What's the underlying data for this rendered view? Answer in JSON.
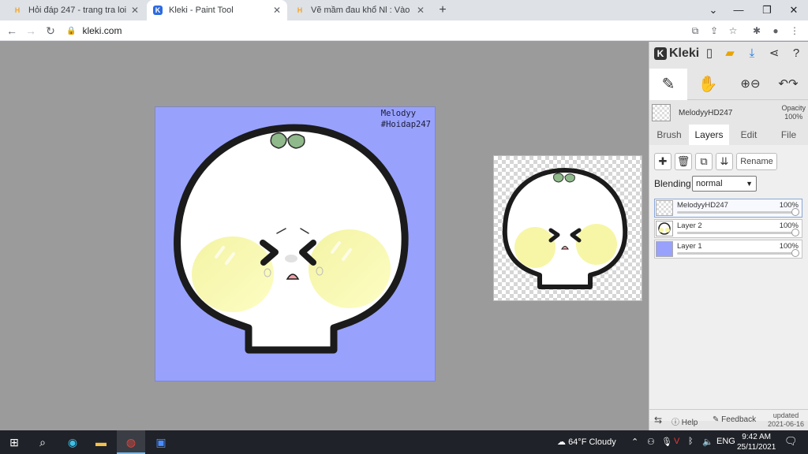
{
  "browser": {
    "tabs": [
      {
        "favicon": "H",
        "title": "Hỏi đáp 247 - trang tra loi",
        "active": false
      },
      {
        "favicon": "K",
        "title": "Kleki - Paint Tool",
        "active": true
      },
      {
        "favicon": "H",
        "title": "Vẽ mầm đau khổ Nl : Vào câu hỏi",
        "active": false
      }
    ],
    "close_glyph": "✕",
    "new_tab_glyph": "+",
    "url": "kleki.com",
    "window_controls": [
      "⌄",
      "—",
      "❐",
      "✕"
    ]
  },
  "artwork": {
    "watermark_line1": "Melodyy",
    "watermark_line2": "#Hoidap247",
    "background_color": "#98a2fd",
    "blush_color": "#fafaa8"
  },
  "kleki": {
    "logo": "Kleki",
    "current_layer_name": "MelodyyHD247",
    "opacity_label": "Opacity",
    "opacity_value": "100%",
    "tabs": [
      "Brush",
      "Layers",
      "Edit",
      "File"
    ],
    "active_tab": "Layers",
    "rename_label": "Rename",
    "blending_label": "Blending",
    "blending_value": "normal",
    "layers": [
      {
        "name": "MelodyyHD247",
        "opacity": "100%",
        "selected": true
      },
      {
        "name": "Layer 2",
        "opacity": "100%",
        "selected": false
      },
      {
        "name": "Layer 1",
        "opacity": "100%",
        "selected": false
      }
    ],
    "footer": {
      "help": "Help",
      "feedback": "Feedback",
      "updated_label": "updated",
      "updated_date": "2021-06-16"
    }
  },
  "taskbar": {
    "weather": "64°F  Cloudy",
    "language": "ENG",
    "time": "9:42 AM",
    "date": "25/11/2021"
  }
}
